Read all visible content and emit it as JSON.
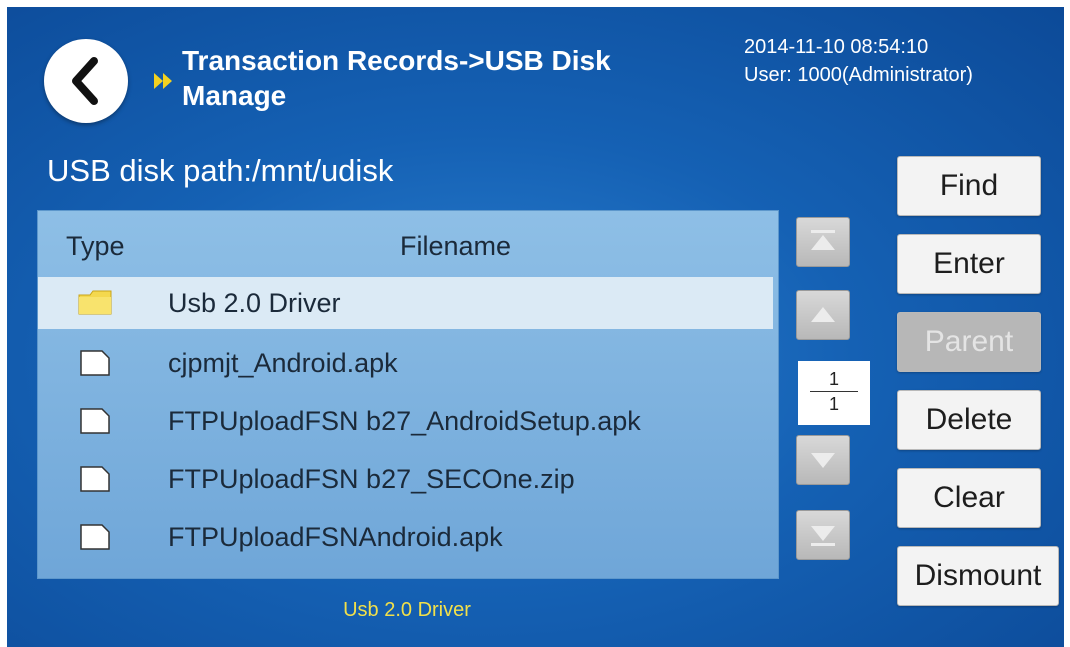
{
  "header": {
    "title": "Transaction Records->USB Disk Manage",
    "datetime": "2014-11-10  08:54:10",
    "user": "User: 1000(Administrator)"
  },
  "path_label": "USB disk path:/mnt/udisk",
  "table": {
    "columns": [
      "Type",
      "Filename"
    ],
    "rows": [
      {
        "type": "folder",
        "name": "Usb 2.0 Driver",
        "selected": true
      },
      {
        "type": "file",
        "name": "cjpmjt_Android.apk",
        "selected": false
      },
      {
        "type": "file",
        "name": "FTPUploadFSN b27_AndroidSetup.apk",
        "selected": false
      },
      {
        "type": "file",
        "name": "FTPUploadFSN b27_SECOne.zip",
        "selected": false
      },
      {
        "type": "file",
        "name": "FTPUploadFSNAndroid.apk",
        "selected": false
      }
    ]
  },
  "pager": {
    "current": "1",
    "total": "1"
  },
  "buttons": {
    "find": "Find",
    "enter": "Enter",
    "parent": "Parent",
    "delete": "Delete",
    "clear": "Clear",
    "dismount": "Dismount"
  },
  "status_text": "Usb 2.0 Driver",
  "colors": {
    "accent": "#1561b4",
    "status": "#f2e04a",
    "selected_row": "#dbeaf5"
  }
}
